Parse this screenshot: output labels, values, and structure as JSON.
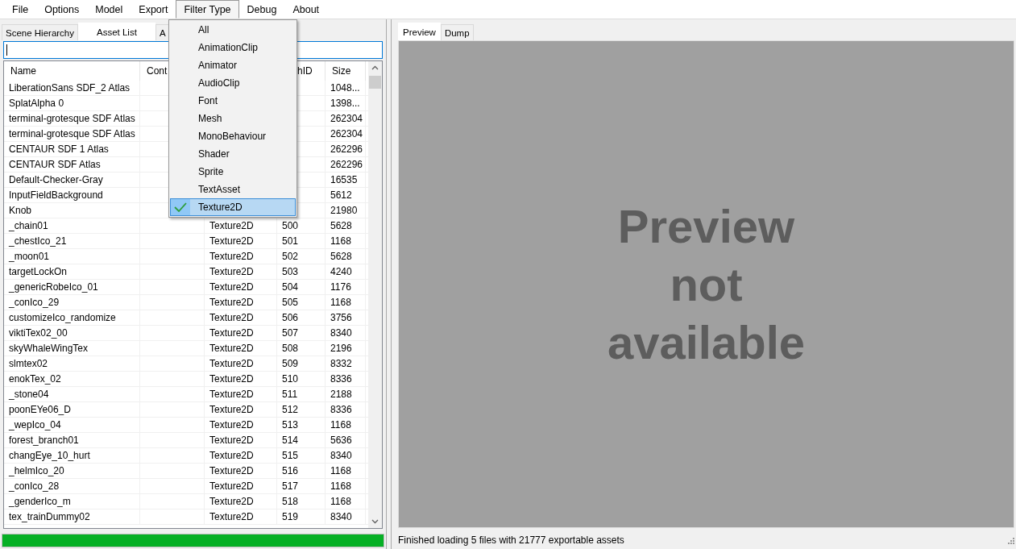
{
  "menu_bar": [
    {
      "label": "File",
      "selected": false
    },
    {
      "label": "Options",
      "selected": false
    },
    {
      "label": "Model",
      "selected": false
    },
    {
      "label": "Export",
      "selected": false
    },
    {
      "label": "Filter Type",
      "selected": true
    },
    {
      "label": "Debug",
      "selected": false
    },
    {
      "label": "About",
      "selected": false
    }
  ],
  "filter_menu": [
    {
      "label": "All",
      "checked": false
    },
    {
      "label": "AnimationClip",
      "checked": false
    },
    {
      "label": "Animator",
      "checked": false
    },
    {
      "label": "AudioClip",
      "checked": false
    },
    {
      "label": "Font",
      "checked": false
    },
    {
      "label": "Mesh",
      "checked": false
    },
    {
      "label": "MonoBehaviour",
      "checked": false
    },
    {
      "label": "Shader",
      "checked": false
    },
    {
      "label": "Sprite",
      "checked": false
    },
    {
      "label": "TextAsset",
      "checked": false
    },
    {
      "label": "Texture2D",
      "checked": true
    }
  ],
  "left_tabs": [
    {
      "label": "Scene Hierarchy",
      "selected": false
    },
    {
      "label": "Asset List",
      "selected": true
    },
    {
      "label": "A",
      "selected": false
    }
  ],
  "search_field": {
    "focused": true
  },
  "table": {
    "columns": [
      {
        "label": "Name"
      },
      {
        "label": "Cont"
      },
      {},
      {
        "label": "hID"
      },
      {
        "label": "Size"
      }
    ],
    "rows": [
      {
        "name": "LiberationSans SDF_2 Atlas",
        "size": "1048..."
      },
      {
        "name": "SplatAlpha 0",
        "size": "1398..."
      },
      {
        "name": "terminal-grotesque SDF Atlas",
        "size": "262304"
      },
      {
        "name": "terminal-grotesque SDF Atlas",
        "size": "262304"
      },
      {
        "name": "CENTAUR SDF 1 Atlas",
        "size": "262296"
      },
      {
        "name": "CENTAUR SDF Atlas",
        "size": "262296"
      },
      {
        "name": "Default-Checker-Gray",
        "size": "16535"
      },
      {
        "name": "InputFieldBackground",
        "size": "5612"
      },
      {
        "name": "Knob",
        "size": "21980"
      },
      {
        "name": "_chain01",
        "type": "Texture2D",
        "path_id": "500",
        "size": "5628"
      },
      {
        "name": "_chestIco_21",
        "type": "Texture2D",
        "path_id": "501",
        "size": "1168"
      },
      {
        "name": "_moon01",
        "type": "Texture2D",
        "path_id": "502",
        "size": "5628"
      },
      {
        "name": "targetLockOn",
        "type": "Texture2D",
        "path_id": "503",
        "size": "4240"
      },
      {
        "name": "_genericRobeIco_01",
        "type": "Texture2D",
        "path_id": "504",
        "size": "1176"
      },
      {
        "name": "_conIco_29",
        "type": "Texture2D",
        "path_id": "505",
        "size": "1168"
      },
      {
        "name": "customizeIco_randomize",
        "type": "Texture2D",
        "path_id": "506",
        "size": "3756"
      },
      {
        "name": "viktiTex02_00",
        "type": "Texture2D",
        "path_id": "507",
        "size": "8340"
      },
      {
        "name": "skyWhaleWingTex",
        "type": "Texture2D",
        "path_id": "508",
        "size": "2196"
      },
      {
        "name": "slmtex02",
        "type": "Texture2D",
        "path_id": "509",
        "size": "8332"
      },
      {
        "name": "enokTex_02",
        "type": "Texture2D",
        "path_id": "510",
        "size": "8336"
      },
      {
        "name": "_stone04",
        "type": "Texture2D",
        "path_id": "511",
        "size": "2188"
      },
      {
        "name": "poonEYe06_D",
        "type": "Texture2D",
        "path_id": "512",
        "size": "8336"
      },
      {
        "name": "_wepIco_04",
        "type": "Texture2D",
        "path_id": "513",
        "size": "1168"
      },
      {
        "name": "forest_branch01",
        "type": "Texture2D",
        "path_id": "514",
        "size": "5636"
      },
      {
        "name": "changEye_10_hurt",
        "type": "Texture2D",
        "path_id": "515",
        "size": "8340"
      },
      {
        "name": "_helmIco_20",
        "type": "Texture2D",
        "path_id": "516",
        "size": "1168"
      },
      {
        "name": "_conIco_28",
        "type": "Texture2D",
        "path_id": "517",
        "size": "1168"
      },
      {
        "name": "_genderIco_m",
        "type": "Texture2D",
        "path_id": "518",
        "size": "1168"
      },
      {
        "name": "tex_trainDummy02",
        "type": "Texture2D",
        "path_id": "519",
        "size": "8340"
      }
    ]
  },
  "progress_bar": {
    "level": 1
  },
  "right_tabs": [
    {
      "label": "Preview",
      "selected": true
    },
    {
      "label": "Dump",
      "selected": false
    }
  ],
  "preview": {
    "message": "Preview not available"
  },
  "status_bar": {
    "text": "Finished loading 5 files with 21777 exportable assets"
  }
}
